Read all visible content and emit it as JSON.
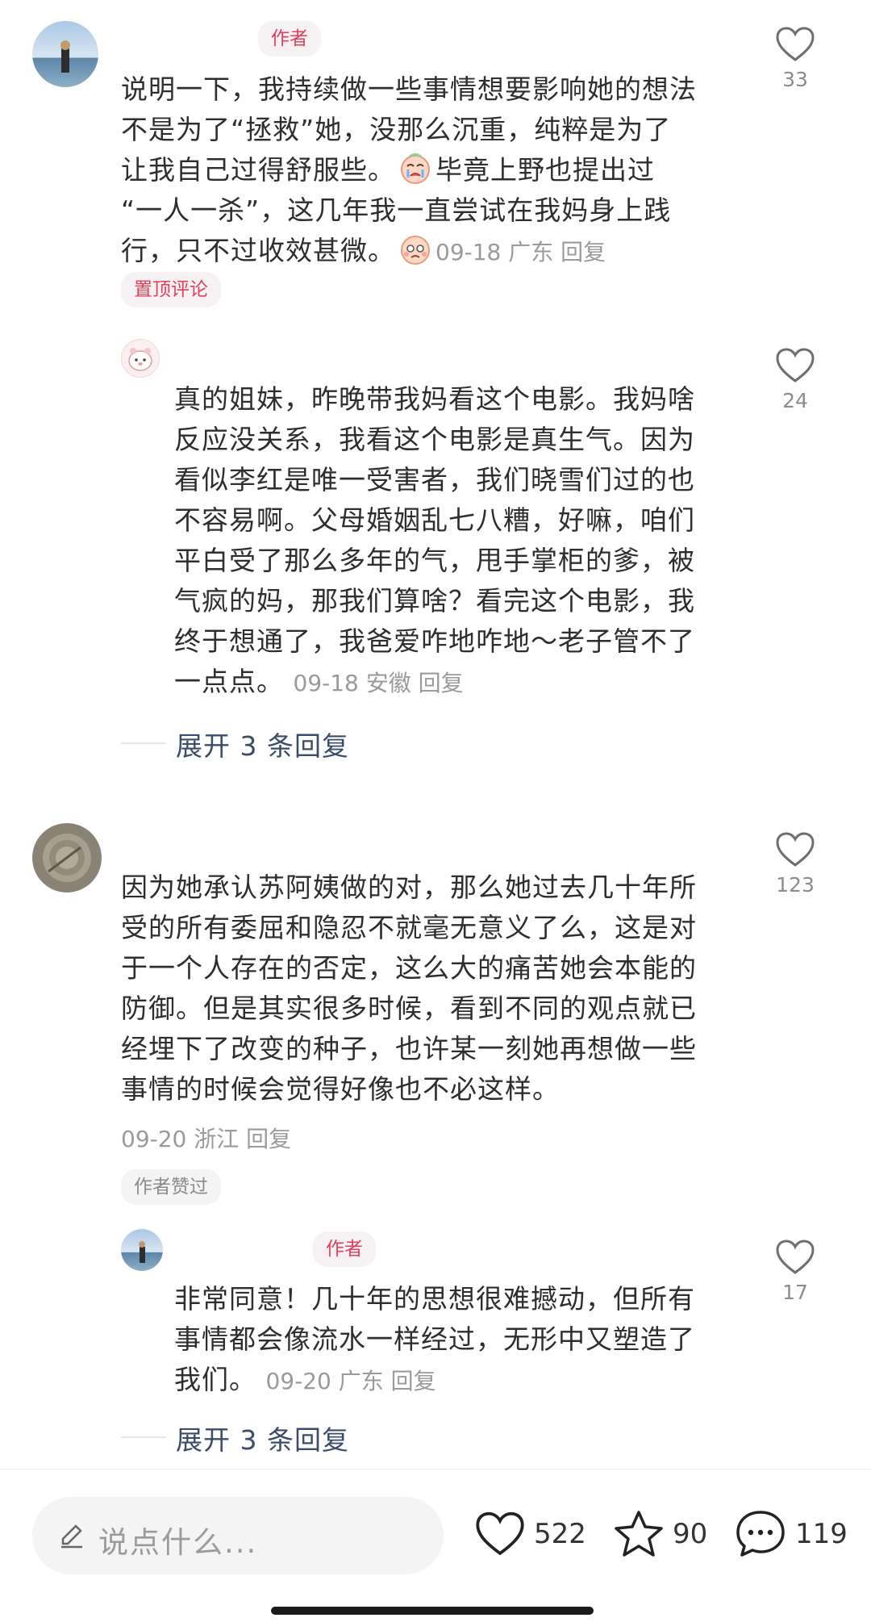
{
  "comments": [
    {
      "tag_author": "作者",
      "text_lines": [
        "说明一下，我持续做一些事情想要影响她的想法",
        "不是为了“拯救”她，没那么沉重，纯粹是为了",
        "让我自己过得舒服些。",
        "“一人一杀”，这几年我一直尝试在我妈身上践",
        "行，只不过收效甚微。"
      ],
      "line3_tail": "毕竟上野也提出过",
      "meta": "09-18 广东 回复",
      "likes": "33",
      "pin_tag": "置顶评论"
    },
    {
      "text_lines": [
        "真的姐妹，昨晚带我妈看这个电影。我妈啥",
        "反应没关系，我看这个电影是真生气。因为",
        "看似李红是唯一受害者，我们晓雪们过的也",
        "不容易啊。父母婚姻乱七八糟，好嘛，咱们",
        "平白受了那么多年的气，甩手掌柜的爹，被",
        "气疯的妈，那我们算啥？看完这个电影，我",
        "终于想通了，我爸爱咋地咋地～老子管不了",
        "一点点。"
      ],
      "meta": "09-18 安徽 回复",
      "likes": "24",
      "expand": "展开 3 条回复"
    },
    {
      "text_lines": [
        "因为她承认苏阿姨做的对，那么她过去几十年所",
        "受的所有委屈和隐忍不就毫无意义了么，这是对",
        "于一个人存在的否定，这么大的痛苦她会本能的",
        "防御。但是其实很多时候，看到不同的观点就已",
        "经埋下了改变的种子，也许某一刻她再想做一些",
        "事情的时候会觉得好像也不必这样。"
      ],
      "meta": "09-20 浙江 回复",
      "likes": "123",
      "liked_tag": "作者赞过"
    },
    {
      "tag_author": "作者",
      "text_lines": [
        "非常同意！几十年的思想很难撼动，但所有",
        "事情都会像流水一样经过，无形中又塑造了",
        "我们。"
      ],
      "meta": "09-20 广东 回复",
      "likes": "17",
      "expand": "展开 3 条回复"
    }
  ],
  "bottom_bar": {
    "input_placeholder": "说点什么...",
    "likes_count": "522",
    "stars_count": "90",
    "comments_count": "119"
  }
}
